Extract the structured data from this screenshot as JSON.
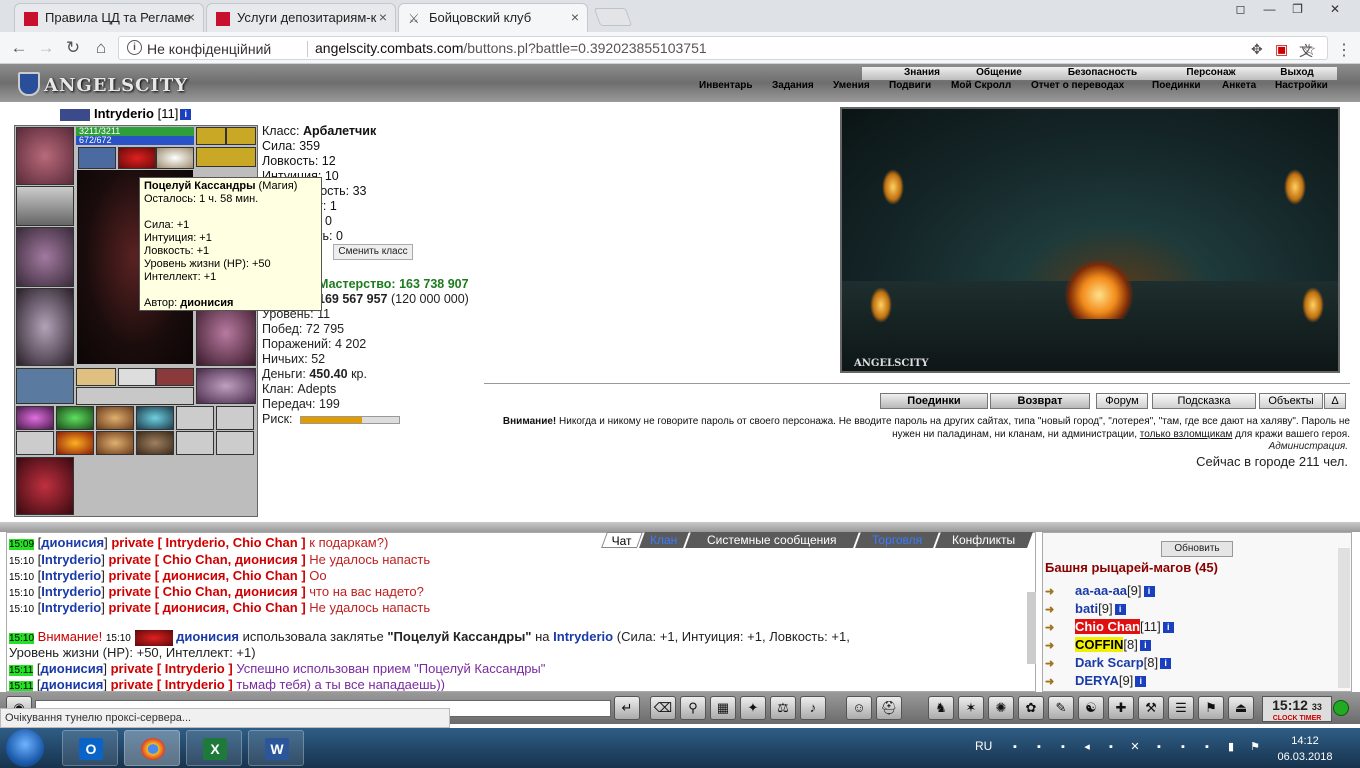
{
  "browser": {
    "tabs": [
      {
        "title": "Правила ЦД та Регламе",
        "active": false
      },
      {
        "title": "Услуги депозитариям-к",
        "active": false
      },
      {
        "title": "Бойцовский клуб",
        "active": true
      }
    ],
    "security_label": "Не конфіденційний",
    "url_host": "angelscity.combats.com",
    "url_path": "/buttons.pl?battle=0.392023855103751",
    "status": "Очікування тунелю проксі-сервера..."
  },
  "game": {
    "logo": "ANGELSCITY",
    "menu_top": [
      "Знания",
      "Общение",
      "Безопасность",
      "Персонаж",
      "Выход"
    ],
    "menu_sub": [
      "Инвентарь",
      "Задания",
      "Умения",
      "Подвиги",
      "Мой Скролл",
      "Отчет о переводах",
      "Поединки",
      "Анкета",
      "Настройки"
    ],
    "player": {
      "name": "Intryderio",
      "level": "[11]",
      "hp": "3211/3211",
      "mp": "672/672",
      "hp_fill": 1.0,
      "mp_fill": 1.0
    }
  },
  "tooltip": {
    "title": "Поцелуй Кассандры",
    "kind": "(Магия)",
    "remaining": "Осталось: 1 ч. 58 мин.",
    "lines": [
      "Сила: +1",
      "Интуиция: +1",
      "Ловкость: +1",
      "Уровень жизни (HP): +50",
      "Интеллект: +1"
    ],
    "author_label": "Автор:",
    "author": "дионисия"
  },
  "stats": {
    "class_label": "Класс:",
    "class_value": "Арбалетчик",
    "rows": [
      "Сила: 359",
      "Ловкость: 12",
      "Интуиция: 10",
      "Выносливость: 33",
      "Интеллект: 1",
      "Мудрость: 0",
      "Духовность: 0"
    ],
    "change_class": "Сменить класс",
    "exp_label": "Мастерство:",
    "exp_value": "163 738 907",
    "next_value": "169 567 957",
    "next_extra": "(120 000 000)",
    "rows2": [
      "Уровень: 11",
      "Побед: 72 795",
      "Поражений: 4 202",
      "Ничьих: 52"
    ],
    "money_label": "Деньги:",
    "money_value": "450.40",
    "money_unit": "кр.",
    "clan": "Клан: Adepts",
    "transfers": "Передач: 199",
    "risk_label": "Риск:",
    "risk_fill": 0.62
  },
  "scene": {
    "label": "ANGELSCITY"
  },
  "nav_buttons": [
    "Поединки",
    "Возврат",
    "Форум",
    "Подсказка",
    "Объекты",
    "Δ"
  ],
  "warning": {
    "bold": "Внимание!",
    "text1": "Никогда и никому не говорите пароль от своего персонажа. Не вводите пароль на других сайтах, типа \"новый город\", \"лотерея\", \"там, где все дают на халяву\". Пароль не нужен ни паладинам, ни кланам, ни администрации,",
    "link": "только взломщикам",
    "text2": "для кражи вашего героя.",
    "admin": "Администрация.",
    "online": "Сейчас в городе 211 чел."
  },
  "chat_tabs": [
    "Чат",
    "Клан",
    "Системные сообщения",
    "Торговля",
    "Конфликты"
  ],
  "chat": [
    {
      "ts": "15:09",
      "green": true,
      "nick": "дионисия",
      "priv": "private [ Intryderio, Chio Chan ]",
      "msg": "к подаркам?)"
    },
    {
      "ts": "15:10",
      "green": false,
      "nick": "Intryderio",
      "priv": "private [ Chio Chan, дионисия ]",
      "msg": "Не удалось напасть"
    },
    {
      "ts": "15:10",
      "green": false,
      "nick": "Intryderio",
      "priv": "private [ дионисия, Chio Chan ]",
      "msg": "Оо"
    },
    {
      "ts": "15:10",
      "green": false,
      "nick": "Intryderio",
      "priv": "private [ Chio Chan, дионисия ]",
      "msg": "что на вас надето?"
    },
    {
      "ts": "15:10",
      "green": false,
      "nick": "Intryderio",
      "priv": "private [ дионисия, Chio Chan ]",
      "msg": "Не удалось напасть"
    }
  ],
  "system_msg": {
    "ts": "15:10",
    "attention": "Внимание!",
    "ts2": "15:10",
    "who": "дионисия",
    "action": "использовала заклятье",
    "spell": "\"Поцелуй Кассандры\"",
    "on": "на",
    "target": "Intryderio",
    "effects": "(Сила: +1, Интуиция: +1, Ловкость: +1,",
    "effects2": "Уровень жизни (HP): +50, Интеллект: +1)"
  },
  "chat_tail": [
    {
      "ts": "15:11",
      "green": true,
      "nick": "дионисия",
      "priv": "private [ Intryderio ]",
      "msg": "Успешно использован прием \"Поцелуй Кассандры\""
    },
    {
      "ts": "15:11",
      "green": true,
      "nick": "дионисия",
      "priv": "private [ Intryderio ]",
      "msg": "тьмаф тебя) а ты все нападаешь))"
    }
  ],
  "side": {
    "refresh": "Обновить",
    "room": "Башня рыцарей-магов (45)",
    "players": [
      {
        "name": "aa-aa-aa",
        "lvl": "[9]",
        "style": ""
      },
      {
        "name": "bati",
        "lvl": "[9]",
        "style": ""
      },
      {
        "name": "Chio Chan",
        "lvl": "[11]",
        "style": "red"
      },
      {
        "name": "COFFIN",
        "lvl": "[8]",
        "style": "yel"
      },
      {
        "name": "Dark Scarp",
        "lvl": "[8]",
        "style": ""
      },
      {
        "name": "DERYA",
        "lvl": "[9]",
        "style": ""
      }
    ]
  },
  "clock": {
    "time": "15:12",
    "sec": "33",
    "label": "CLOCK TIMER"
  },
  "taskbar": {
    "lang": "RU",
    "time": "14:12",
    "date": "06.03.2018"
  }
}
